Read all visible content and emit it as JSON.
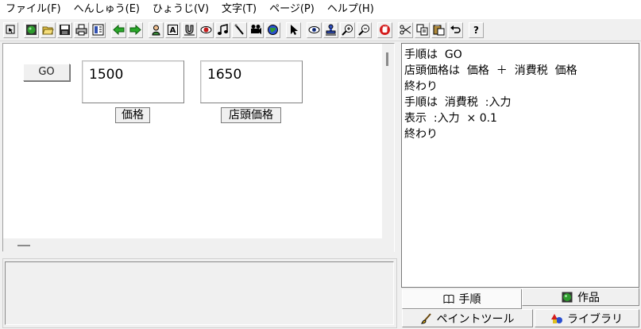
{
  "menu": {
    "items": [
      "ファイル(F)",
      "へんしゅう(E)",
      "ひょうじ(V)",
      "文字(T)",
      "ページ(P)",
      "ヘルプ(H)"
    ]
  },
  "toolbar": {
    "buttons": [
      {
        "name": "pointer-mode-icon"
      },
      {
        "name": "new-work-icon"
      },
      {
        "name": "open-folder-icon"
      },
      {
        "name": "save-icon"
      },
      {
        "name": "print-icon"
      },
      {
        "name": "layout-icon"
      },
      {
        "name": "back-arrow-icon"
      },
      {
        "name": "forward-arrow-icon"
      },
      {
        "name": "character-icon"
      },
      {
        "name": "text-box-icon"
      },
      {
        "name": "magnet-icon"
      },
      {
        "name": "eye-lens-icon"
      },
      {
        "name": "music-note-icon"
      },
      {
        "name": "pen-icon"
      },
      {
        "name": "movie-camera-icon"
      },
      {
        "name": "globe-icon"
      },
      {
        "name": "select-arrow-icon"
      },
      {
        "name": "eye-icon"
      },
      {
        "name": "stamp-icon"
      },
      {
        "name": "zoom-in-icon"
      },
      {
        "name": "zoom-out-icon"
      },
      {
        "name": "stop-hand-icon"
      },
      {
        "name": "cut-icon"
      },
      {
        "name": "copy-icon"
      },
      {
        "name": "paste-icon"
      },
      {
        "name": "undo-icon"
      },
      {
        "name": "help-icon",
        "label": "?"
      }
    ],
    "text_box_label": "A"
  },
  "canvas": {
    "go_button": "GO",
    "price_value": "1500",
    "store_price_value": "1650",
    "price_label": "価格",
    "store_price_label": "店頭価格"
  },
  "code": {
    "lines": [
      "手順は  GO",
      "店頭価格は  価格  ＋  消費税  価格",
      "終わり",
      "手順は  消費税  :入力",
      "表示  :入力  × 0.1",
      "終わり"
    ]
  },
  "tabs": {
    "procedure": "手順",
    "works": "作品",
    "paint_tool": "ペイントツール",
    "library": "ライブラリ"
  },
  "colors": {
    "go_green": "#1a8a1a",
    "stop_red": "#d41c1c",
    "globe_blue": "#2a4fd0"
  }
}
